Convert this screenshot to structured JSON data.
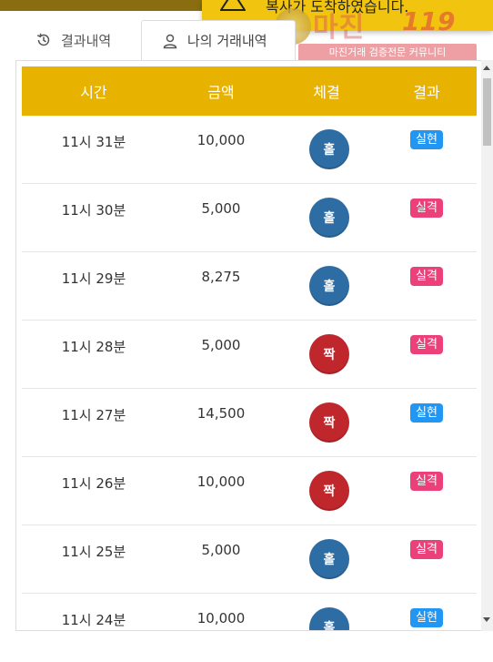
{
  "toast": {
    "message": "복사가 도착하였습니다."
  },
  "watermark": {
    "title": "마진",
    "number": "119",
    "tagline": "마진거래 검증전문 커뮤니티"
  },
  "tabs": [
    {
      "label": "결과내역",
      "icon": "history-icon"
    },
    {
      "label": "나의 거래내역",
      "icon": "user-icon"
    }
  ],
  "table": {
    "headers": [
      "시간",
      "금액",
      "체결",
      "결과"
    ],
    "rows": [
      {
        "time": "11시 31분",
        "amount": "10,000",
        "fill": "홀",
        "result": "실현"
      },
      {
        "time": "11시 30분",
        "amount": "5,000",
        "fill": "홀",
        "result": "실격"
      },
      {
        "time": "11시 29분",
        "amount": "8,275",
        "fill": "홀",
        "result": "실격"
      },
      {
        "time": "11시 28분",
        "amount": "5,000",
        "fill": "짝",
        "result": "실격"
      },
      {
        "time": "11시 27분",
        "amount": "14,500",
        "fill": "짝",
        "result": "실현"
      },
      {
        "time": "11시 26분",
        "amount": "10,000",
        "fill": "짝",
        "result": "실격"
      },
      {
        "time": "11시 25분",
        "amount": "5,000",
        "fill": "홀",
        "result": "실격"
      },
      {
        "time": "11시 24분",
        "amount": "10,000",
        "fill": "홀",
        "result": "실현"
      }
    ]
  },
  "colors": {
    "header_bg": "#e8b300",
    "odd_ball": "#2e6da4",
    "even_ball": "#c0272d",
    "success_badge": "#2196f3",
    "fail_badge": "#ec407a"
  }
}
